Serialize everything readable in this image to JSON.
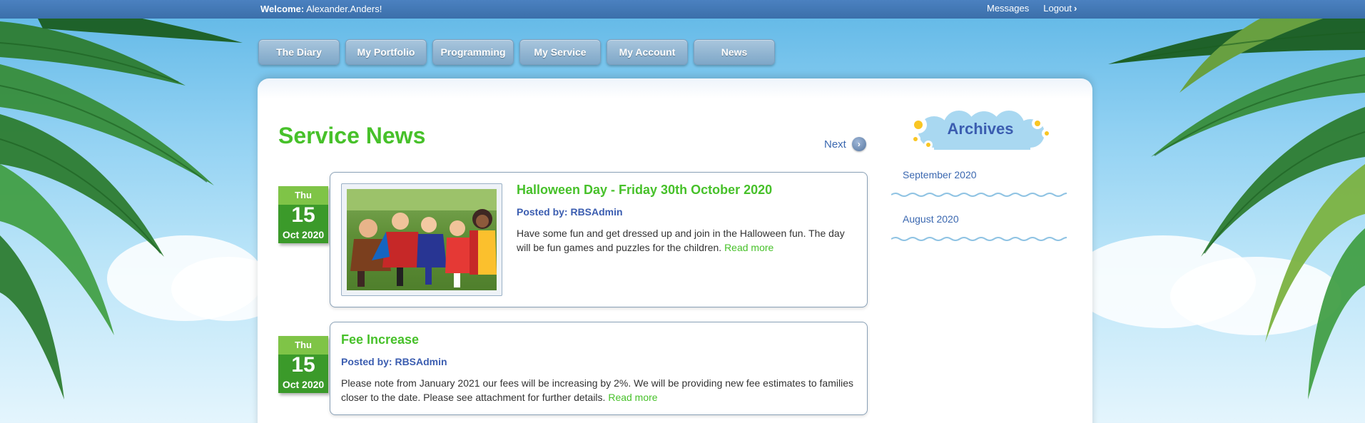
{
  "topbar": {
    "welcome_label": "Welcome:",
    "user_name": "Alexander.Anders!",
    "messages_label": "Messages",
    "logout_label": "Logout"
  },
  "nav": {
    "items": [
      {
        "label": "The Diary"
      },
      {
        "label": "My Portfolio"
      },
      {
        "label": "Programming"
      },
      {
        "label": "My Service"
      },
      {
        "label": "My Account"
      },
      {
        "label": "News"
      }
    ]
  },
  "main": {
    "title": "Service News",
    "next_label": "Next",
    "articles": [
      {
        "dow": "Thu",
        "day": "15",
        "month_year": "Oct 2020",
        "title": "Halloween Day - Friday 30th October 2020",
        "posted_by": "Posted by: RBSAdmin",
        "body": "Have some fun and get dressed up and join in the Halloween fun. The day will be fun games and puzzles for the children.",
        "read_more": "Read more"
      },
      {
        "dow": "Thu",
        "day": "15",
        "month_year": "Oct 2020",
        "title": "Fee Increase",
        "posted_by": "Posted by: RBSAdmin",
        "body": "Please note from January 2021 our fees will be increasing by 2%. We will be providing new fee estimates to families closer to the date. Please see attachment for further details.",
        "read_more": "Read more"
      }
    ]
  },
  "archives": {
    "title": "Archives",
    "items": [
      {
        "label": "September 2020"
      },
      {
        "label": "August 2020"
      }
    ]
  },
  "colors": {
    "accent_green": "#47c12a",
    "link_blue": "#3b68b0",
    "topbar_blue": "#4b81c0"
  }
}
